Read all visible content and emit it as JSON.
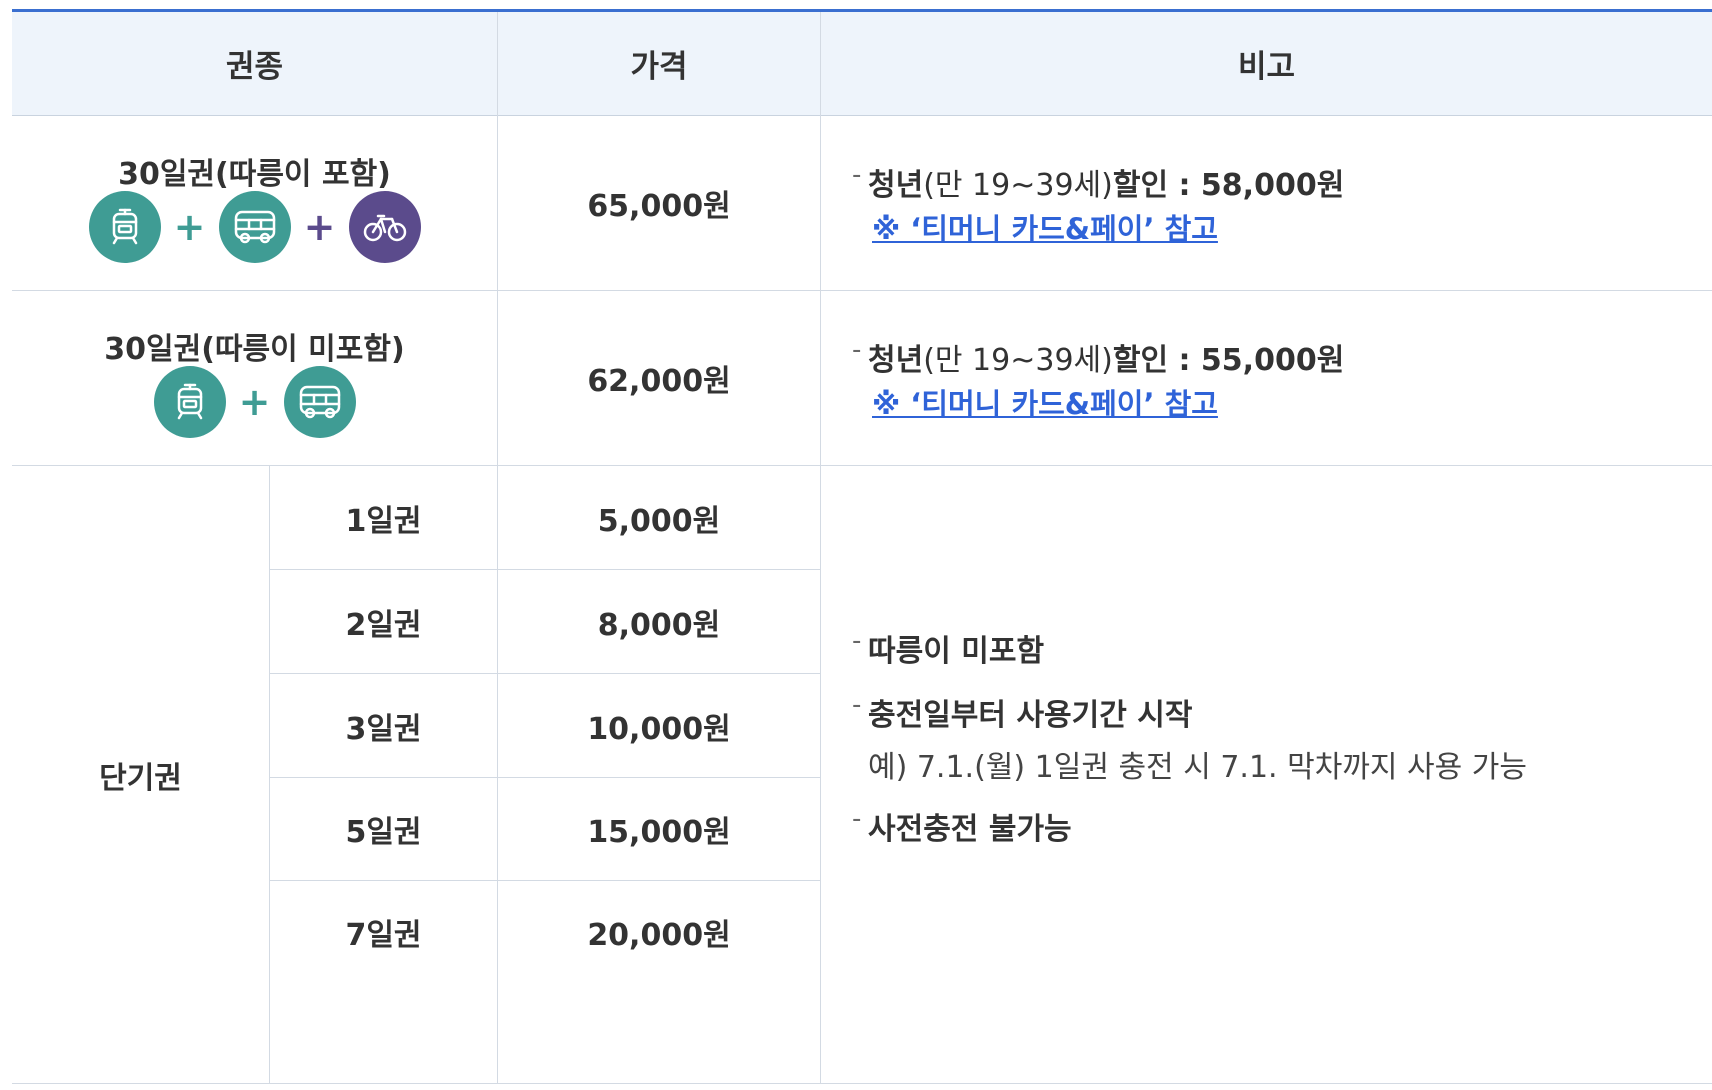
{
  "header": {
    "col_kind": "권종",
    "col_price": "가격",
    "col_note": "비고"
  },
  "rows": {
    "r30_incl": {
      "kind": "30일권(따릉이 포함)",
      "price": "65,000원",
      "note_youth_label": "청년",
      "note_youth_age": "(만 19~39세)",
      "note_discount_label": "할인 : 58,000원",
      "note_link": "※ ‘티머니 카드&페이’ 참고",
      "icons": [
        "subway-icon",
        "bus-icon",
        "bicycle-icon"
      ]
    },
    "r30_excl": {
      "kind": "30일권(따릉이 미포함)",
      "price": "62,000원",
      "note_youth_label": "청년",
      "note_youth_age": "(만 19~39세)",
      "note_discount_label": "할인 : 55,000원",
      "note_link": "※ ‘티머니 카드&페이’ 참고",
      "icons": [
        "subway-icon",
        "bus-icon"
      ]
    },
    "short": {
      "group_label": "단기권",
      "items": [
        {
          "kind": "1일권",
          "price": "5,000원"
        },
        {
          "kind": "2일권",
          "price": "8,000원"
        },
        {
          "kind": "3일권",
          "price": "10,000원"
        },
        {
          "kind": "5일권",
          "price": "15,000원"
        },
        {
          "kind": "7일권",
          "price": "20,000원"
        }
      ],
      "notes": {
        "n1": "따릉이 미포함",
        "n2": "충전일부터 사용기간 시작",
        "n2_example": "예) 7.1.(월) 1일권 충전 시 7.1. 막차까지 사용 가능",
        "n3": "사전충전 불가능"
      }
    }
  },
  "colors": {
    "accent": "#3a6fd0",
    "header_bg": "#eef4fb",
    "teal": "#3f9c94",
    "purple": "#5b4b8c",
    "link": "#2f63d8"
  },
  "plus_sign": "+",
  "dash": "-"
}
